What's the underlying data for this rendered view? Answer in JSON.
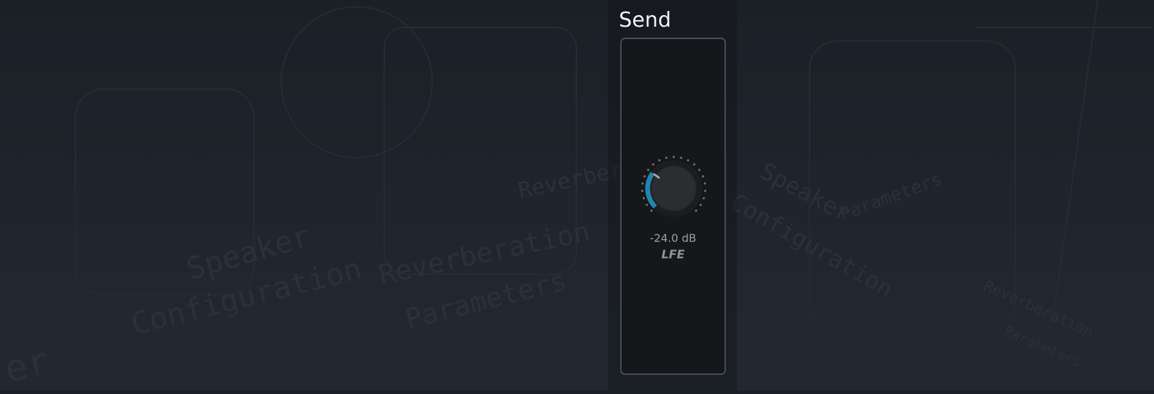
{
  "send": {
    "title": "Send",
    "lfe_knob": {
      "value_text": "-24.0 dB",
      "label": "LFE",
      "level_fraction": 0.3
    }
  },
  "colors": {
    "accent": "#1f86ad",
    "strip_border": "#4a4e55",
    "background": "#1e232b"
  },
  "background_text": {
    "words": [
      "Speaker",
      "Configuration",
      "Reverberation",
      "Parameters",
      "er"
    ]
  }
}
